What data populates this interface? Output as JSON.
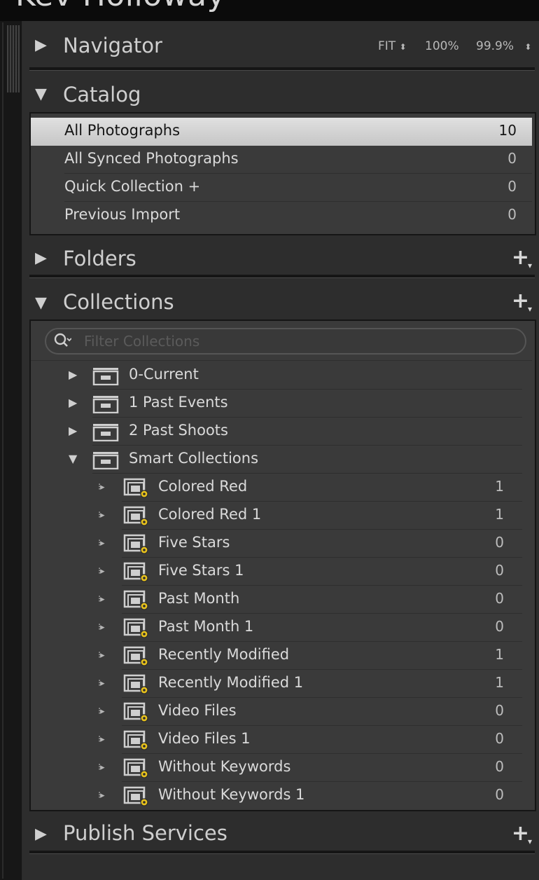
{
  "window": {
    "title": "Kev Holloway"
  },
  "navigator": {
    "label": "Navigator",
    "expanded": false,
    "zoom_fit": "FIT",
    "zoom_100": "100%",
    "zoom_custom": "99.9%"
  },
  "catalog": {
    "label": "Catalog",
    "expanded": true,
    "items": [
      {
        "label": "All Photographs",
        "count": "10",
        "selected": true
      },
      {
        "label": "All Synced Photographs",
        "count": "0"
      },
      {
        "label": "Quick Collection  +",
        "count": "0"
      },
      {
        "label": "Previous Import",
        "count": "0"
      }
    ]
  },
  "folders": {
    "label": "Folders",
    "expanded": false,
    "add_label": "+"
  },
  "collections": {
    "label": "Collections",
    "expanded": true,
    "add_label": "+",
    "filter_placeholder": "Filter Collections",
    "sets": [
      {
        "label": "0-Current",
        "expanded": false
      },
      {
        "label": "1 Past Events",
        "expanded": false
      },
      {
        "label": "2 Past Shoots",
        "expanded": false
      },
      {
        "label": "Smart Collections",
        "expanded": true
      }
    ],
    "smart": [
      {
        "label": "Colored Red",
        "count": "1"
      },
      {
        "label": "Colored Red 1",
        "count": "1"
      },
      {
        "label": "Five Stars",
        "count": "0"
      },
      {
        "label": "Five Stars 1",
        "count": "0"
      },
      {
        "label": "Past Month",
        "count": "0"
      },
      {
        "label": "Past Month 1",
        "count": "0"
      },
      {
        "label": "Recently Modified",
        "count": "1"
      },
      {
        "label": "Recently Modified 1",
        "count": "1"
      },
      {
        "label": "Video Files",
        "count": "0"
      },
      {
        "label": "Video Files 1",
        "count": "0"
      },
      {
        "label": "Without Keywords",
        "count": "0"
      },
      {
        "label": "Without Keywords 1",
        "count": "0"
      }
    ]
  },
  "publish_services": {
    "label": "Publish Services",
    "expanded": false,
    "add_label": "+"
  },
  "colors": {
    "panel_bg": "#2d2d2d",
    "list_bg": "#3a3a3a",
    "selected_row": "#d4d4d4",
    "text": "#dadada"
  }
}
